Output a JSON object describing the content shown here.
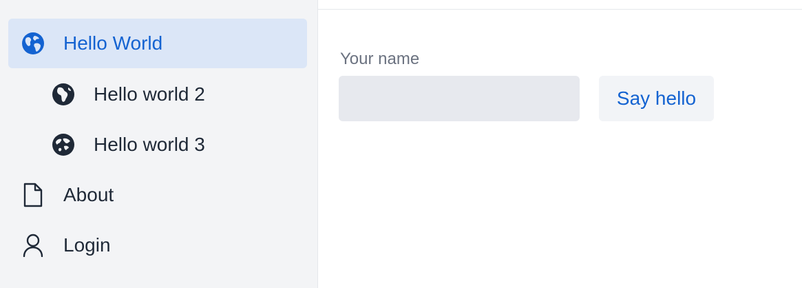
{
  "sidebar": {
    "items": [
      {
        "label": "Hello World",
        "icon": "globe-icon",
        "active": true
      },
      {
        "label": "Hello world 2",
        "icon": "globe-africa-icon",
        "active": false
      },
      {
        "label": "Hello world 3",
        "icon": "globe-asia-icon",
        "active": false
      },
      {
        "label": "About",
        "icon": "document-icon",
        "active": false
      },
      {
        "label": "Login",
        "icon": "user-icon",
        "active": false
      }
    ]
  },
  "main": {
    "name_label": "Your name",
    "name_value": "",
    "say_hello_label": "Say hello"
  },
  "colors": {
    "accent": "#1463d1",
    "active_bg": "#dbe6f7",
    "sidebar_bg": "#f3f4f6",
    "text": "#1f2937"
  }
}
